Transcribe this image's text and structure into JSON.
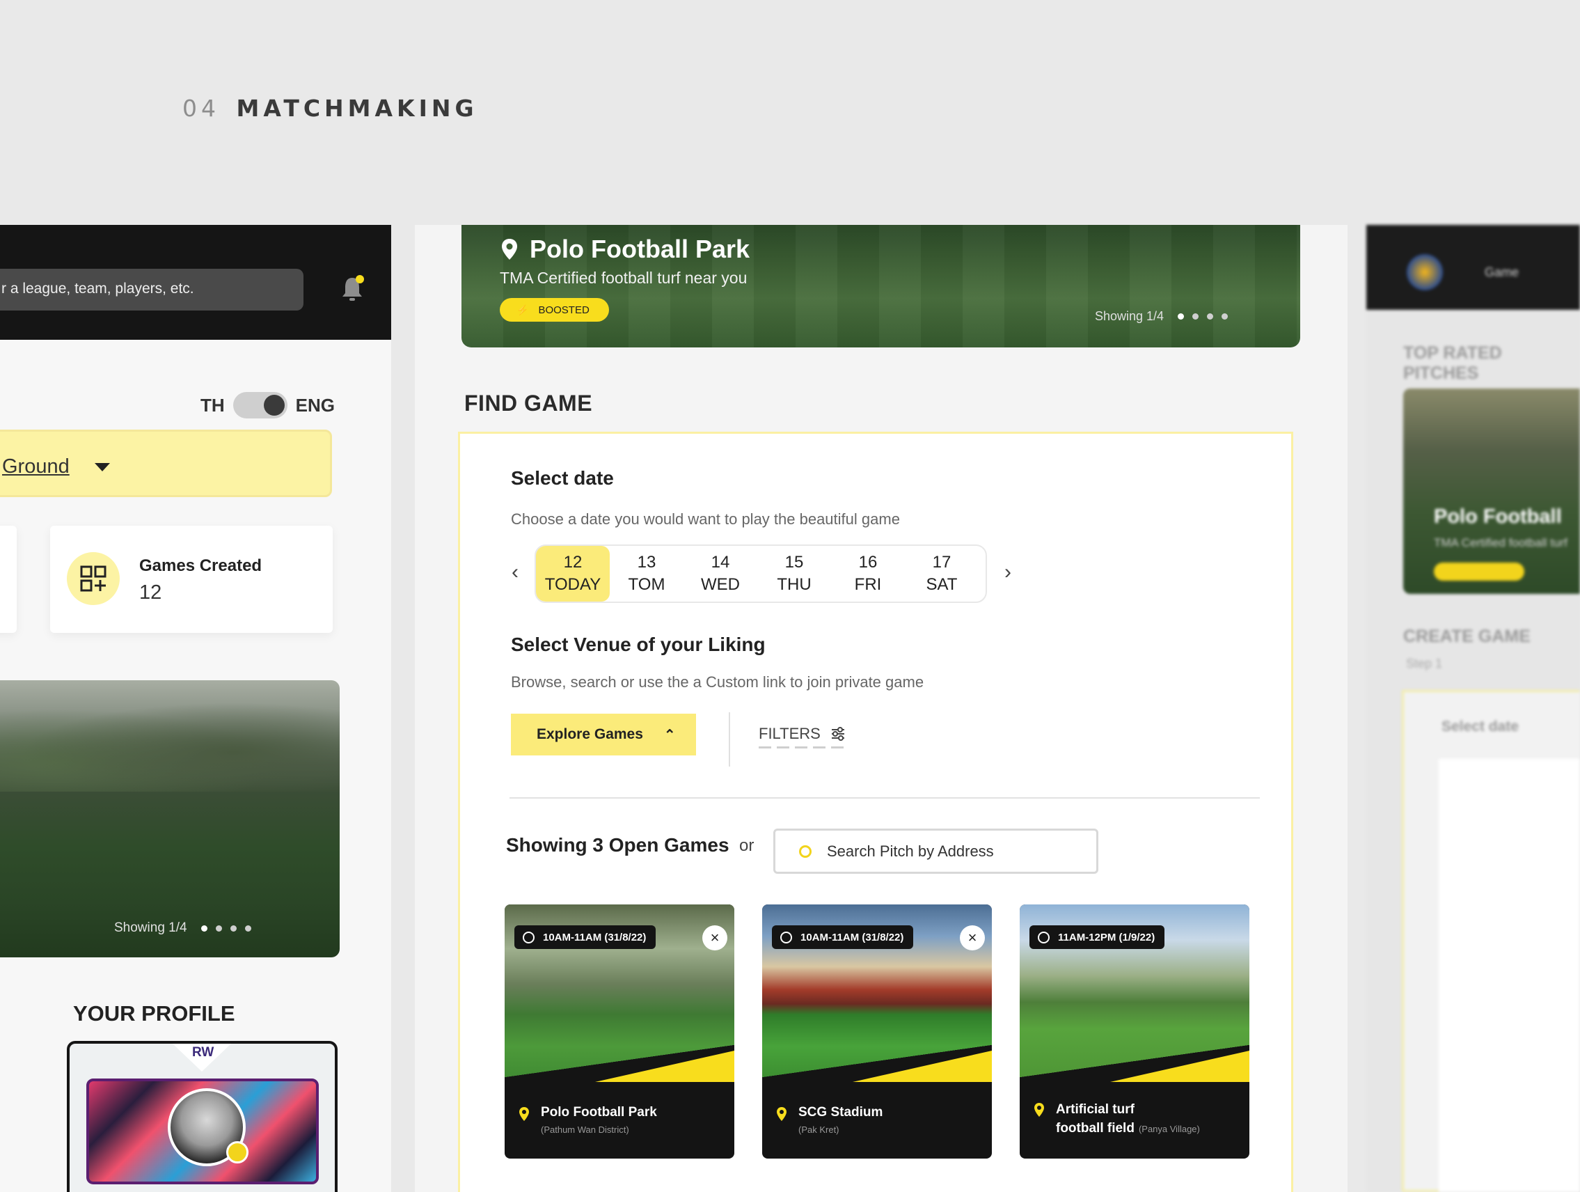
{
  "page": {
    "section_number": "04",
    "section_title": "MATCHMAKING"
  },
  "left_panel": {
    "search_placeholder": "r a league, team, players, etc.",
    "language": {
      "left": "TH",
      "right": "ENG"
    },
    "ground_select": "Ground",
    "stat": {
      "label": "Games Created",
      "value": "12"
    },
    "hero_showing": "Showing 1/4",
    "profile_title": "YOUR PROFILE",
    "position_badge": "RW"
  },
  "hero": {
    "title": "Polo Football Park",
    "subtitle": "TMA Certified football turf near you",
    "badge": "BOOSTED",
    "showing": "Showing 1/4"
  },
  "find_game": {
    "title": "FIND GAME",
    "select_date_title": "Select date",
    "select_date_sub": "Choose a date you would want to play the beautiful game",
    "dates": [
      {
        "day": "12",
        "label": "TODAY"
      },
      {
        "day": "13",
        "label": "TOM"
      },
      {
        "day": "14",
        "label": "WED"
      },
      {
        "day": "15",
        "label": "THU"
      },
      {
        "day": "16",
        "label": "FRI"
      },
      {
        "day": "17",
        "label": "SAT"
      }
    ],
    "venue_title": "Select Venue of your Liking",
    "venue_sub": "Browse, search or use the a Custom link to join private game",
    "explore_button": "Explore Games",
    "filters_label": "FILTERS",
    "showing_games": "Showing 3 Open Games",
    "or": "or",
    "search_placeholder": "Search Pitch by Address",
    "games": [
      {
        "time": "10AM-11AM (31/8/22)",
        "name": "Polo Football Park",
        "location": "(Pathum Wan District)"
      },
      {
        "time": "10AM-11AM (31/8/22)",
        "name": "SCG Stadium",
        "location": "(Pak Kret)"
      },
      {
        "time": "11AM-12PM (1/9/22)",
        "name_line1": "Artificial turf",
        "name_line2": "football field",
        "location": "(Panya Village)"
      }
    ]
  },
  "right_panel": {
    "nav_item": "Game",
    "section1": "TOP RATED PITCHES",
    "card_title": "Polo Football",
    "card_sub": "TMA Certified football turf",
    "section2": "CREATE GAME",
    "step": "Step 1",
    "form_label": "Select date"
  },
  "colors": {
    "accent_yellow": "#f8dd1d",
    "light_yellow": "#fbeb7a",
    "dark": "#141414"
  }
}
